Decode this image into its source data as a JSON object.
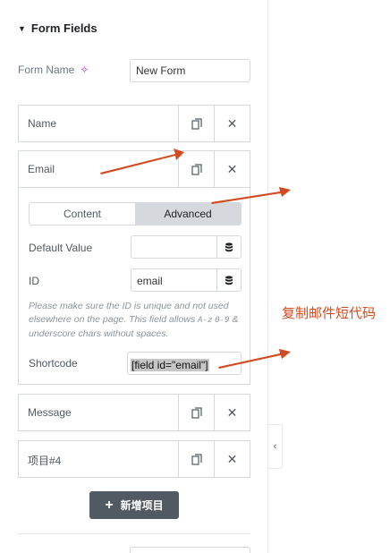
{
  "section": {
    "title": "Form Fields",
    "caret_icon": "caret-down-icon"
  },
  "form_name": {
    "label": "Form Name",
    "ai_icon": "sparkle-icon",
    "value": "New Form"
  },
  "items": [
    {
      "title": "Name"
    },
    {
      "title": "Email"
    }
  ],
  "email_settings": {
    "tabs": [
      {
        "label": "Content"
      },
      {
        "label": "Advanced"
      }
    ],
    "active_tab": "Advanced",
    "default_value": {
      "label": "Default Value",
      "value": ""
    },
    "id": {
      "label": "ID",
      "value": "email"
    },
    "note": {
      "text_1": "Please make sure the ID is unique and not used elsewhere on the page. This field allows ",
      "code_1": "A-z",
      "text_2": " ",
      "code_2": "0-9",
      "text_3": " & underscore chars without spaces."
    },
    "shortcode": {
      "label": "Shortcode",
      "value": "[field id=\"email\"]"
    }
  },
  "items_after": [
    {
      "title": "Message"
    },
    {
      "title": "项目#4"
    }
  ],
  "add_button": {
    "label": "新增项目"
  },
  "annotation": {
    "text": "复制邮件短代码",
    "color": "#d24a1f"
  },
  "colors": {
    "accent_dark": "#515962",
    "border": "#d5d8dc",
    "annotation": "#d24a1f"
  }
}
